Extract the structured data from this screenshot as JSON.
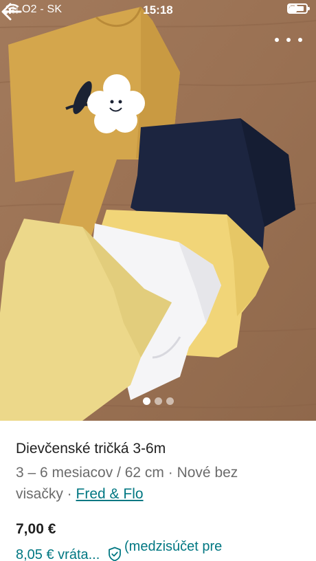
{
  "status_bar": {
    "carrier": "O2 - SK",
    "time": "15:18"
  },
  "icons": {
    "back": "arrow-left-icon",
    "more": "more-horizontal-icon",
    "wifi": "wifi-icon",
    "battery": "battery-icon",
    "lock": "orientation-lock-icon",
    "alarm": "alarm-clock-icon",
    "protection": "shield-check-icon"
  },
  "carousel": {
    "total": 3,
    "active_index": 0
  },
  "item": {
    "title": "Dievčenské tričká 3-6m",
    "size_condition": "3 – 6 mesiacov / 62 cm · Nové bez",
    "condition_rest": "visačky · ",
    "brand": "Fred & Flo",
    "price": "7,00 €",
    "total_price": "8,05 € vráta...",
    "protection_note": "(medzisúčet pre"
  },
  "colors": {
    "accent": "#007782",
    "muted_text": "#6b6b6b",
    "primary_text": "#1f1f1f"
  }
}
